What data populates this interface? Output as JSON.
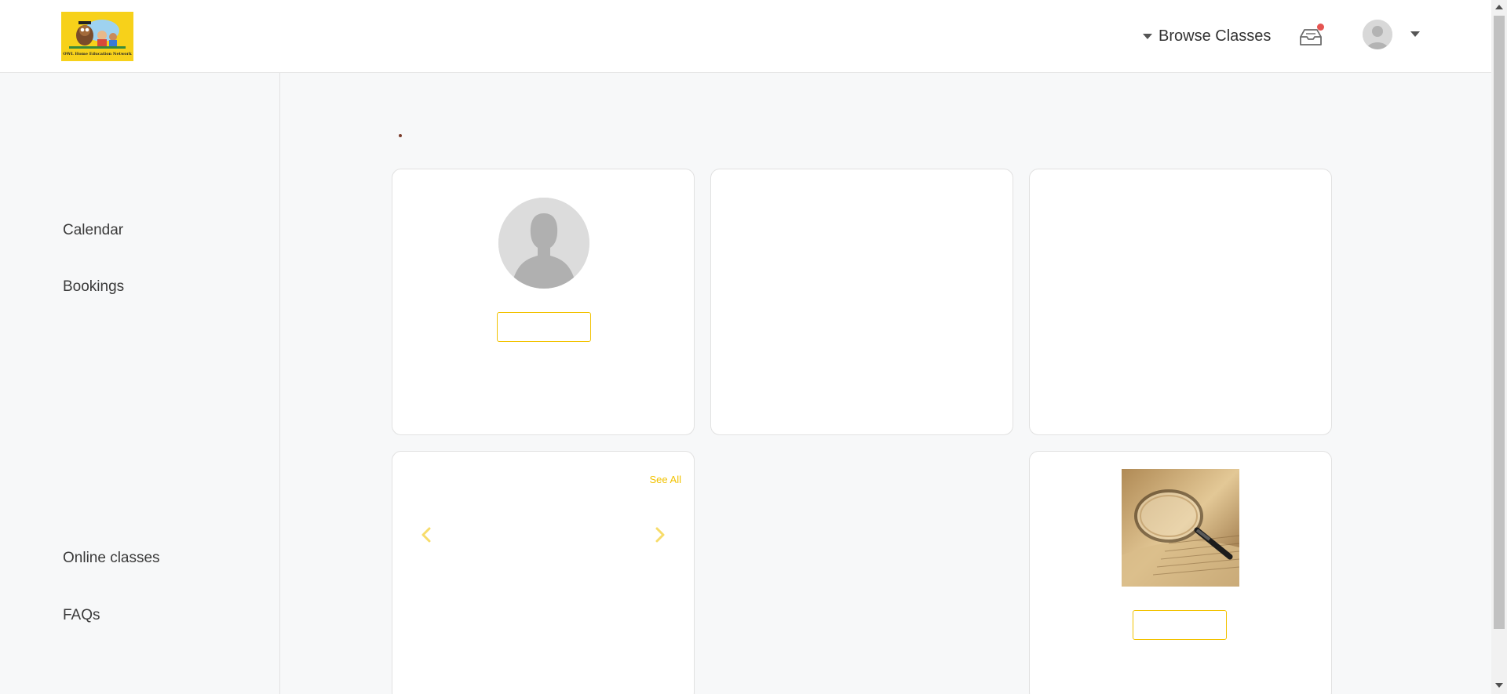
{
  "header": {
    "logo_text": "OWL Home Education Network",
    "browse_label": "Browse Classes",
    "notification_badge": true
  },
  "sidebar": {
    "items": [
      {
        "label": "Calendar"
      },
      {
        "label": "Bookings"
      },
      {
        "label": "Online classes"
      },
      {
        "label": "FAQs"
      }
    ]
  },
  "main": {
    "classes_card": {
      "see_all_label": "See All"
    }
  },
  "colors": {
    "accent": "#f2c200",
    "notification": "#e55451",
    "logo_bg": "#f7d11a"
  },
  "icons": [
    "inbox-icon",
    "chevron-left-icon",
    "chevron-right-icon",
    "caret-down-icon",
    "avatar-placeholder-icon"
  ]
}
